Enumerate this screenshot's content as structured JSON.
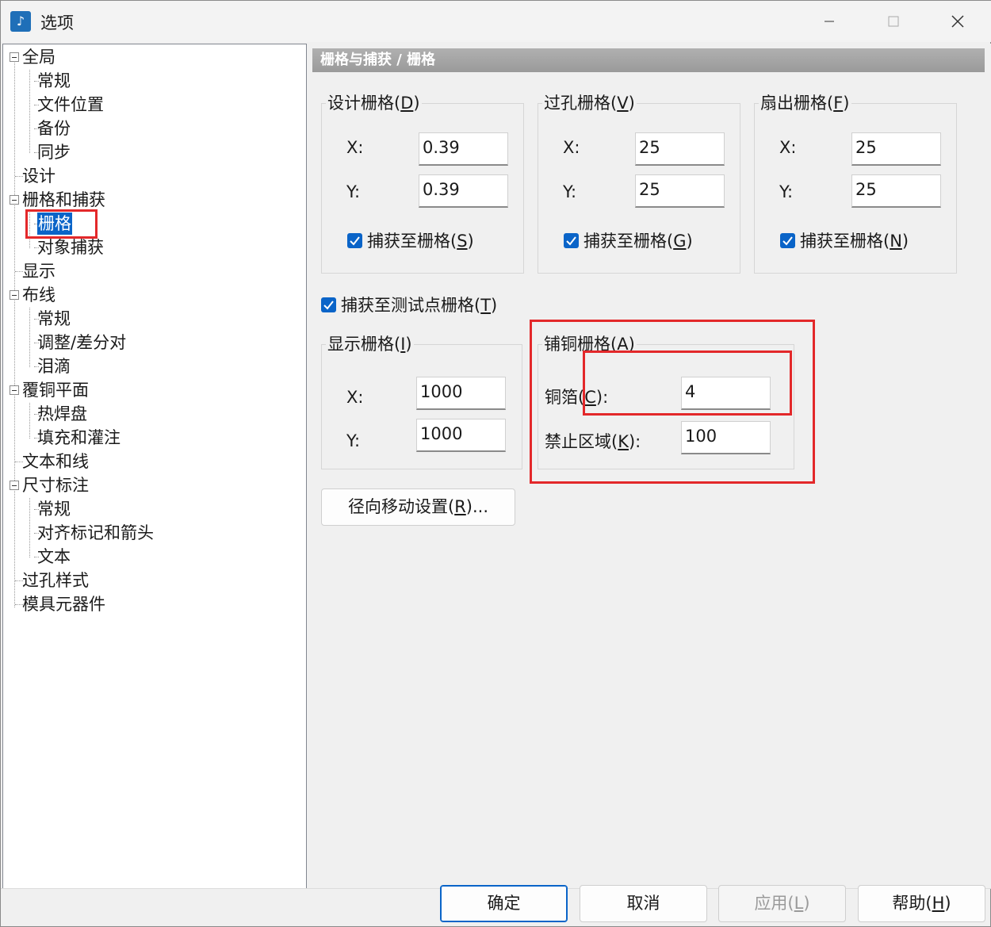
{
  "window": {
    "title": "选项"
  },
  "tree": {
    "items": [
      {
        "label": "全局"
      },
      {
        "label": "常规"
      },
      {
        "label": "文件位置"
      },
      {
        "label": "备份"
      },
      {
        "label": "同步"
      },
      {
        "label": "设计"
      },
      {
        "label": "栅格和捕获"
      },
      {
        "label": "栅格",
        "selected": true
      },
      {
        "label": "对象捕获"
      },
      {
        "label": "显示"
      },
      {
        "label": "布线"
      },
      {
        "label": "常规"
      },
      {
        "label": "调整/差分对"
      },
      {
        "label": "泪滴"
      },
      {
        "label": "覆铜平面"
      },
      {
        "label": "热焊盘"
      },
      {
        "label": "填充和灌注"
      },
      {
        "label": "文本和线"
      },
      {
        "label": "尺寸标注"
      },
      {
        "label": "常规"
      },
      {
        "label": "对齐标记和箭头"
      },
      {
        "label": "文本"
      },
      {
        "label": "过孔样式"
      },
      {
        "label": "模具元器件"
      }
    ]
  },
  "header": {
    "title": "栅格与捕获 / 栅格"
  },
  "design_grid": {
    "label_prefix": "设计栅格(",
    "label_key": "D",
    "label_suffix": ")",
    "x_label": "X:",
    "x_value": "0.39",
    "y_label": "Y:",
    "y_value": "0.39",
    "snap_prefix": "捕获至栅格(",
    "snap_key": "S",
    "snap_suffix": ")",
    "snap_checked": true
  },
  "via_grid": {
    "label_prefix": "过孔栅格(",
    "label_key": "V",
    "label_suffix": ")",
    "x_label": "X:",
    "x_value": "25",
    "y_label": "Y:",
    "y_value": "25",
    "snap_prefix": "捕获至栅格(",
    "snap_key": "G",
    "snap_suffix": ")",
    "snap_checked": true
  },
  "fanout_grid": {
    "label_prefix": "扇出栅格(",
    "label_key": "F",
    "label_suffix": ")",
    "x_label": "X:",
    "x_value": "25",
    "y_label": "Y:",
    "y_value": "25",
    "snap_prefix": "捕获至栅格(",
    "snap_key": "N",
    "snap_suffix": ")",
    "snap_checked": true
  },
  "test_point": {
    "prefix": "捕获至测试点栅格(",
    "key": "T",
    "suffix": ")",
    "checked": true
  },
  "display_grid": {
    "label_prefix": "显示栅格(",
    "label_key": "I",
    "label_suffix": ")",
    "x_label": "X:",
    "x_value": "1000",
    "y_label": "Y:",
    "y_value": "1000"
  },
  "copper_grid": {
    "label_prefix": "铺铜栅格(",
    "label_key": "A",
    "label_suffix": ")",
    "foil_prefix": "铜箔(",
    "foil_key": "C",
    "foil_suffix": "):",
    "foil_value": "4",
    "keepout_prefix": "禁止区域(",
    "keepout_key": "K",
    "keepout_suffix": "):",
    "keepout_value": "100"
  },
  "radial": {
    "prefix": "径向移动设置(",
    "key": "R",
    "suffix": ")..."
  },
  "footer": {
    "ok": "确定",
    "cancel": "取消",
    "apply_prefix": "应用(",
    "apply_key": "L",
    "apply_suffix": ")",
    "help_prefix": "帮助(",
    "help_key": "H",
    "help_suffix": ")"
  },
  "colors": {
    "accent": "#0a64c8",
    "highlight": "#e3282a"
  }
}
